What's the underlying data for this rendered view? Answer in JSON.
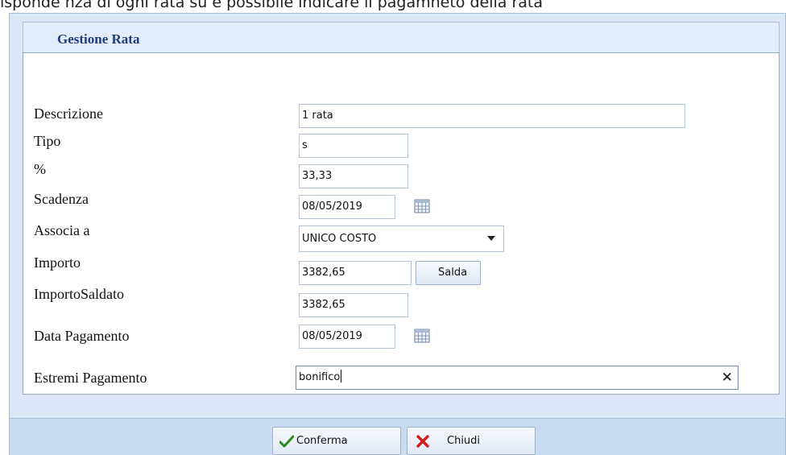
{
  "caption": {
    "text": "isponde nza di ogni rata su        è possibile indicare il pagamneto della rata"
  },
  "dialog": {
    "title": "Gestione Rata"
  },
  "form": {
    "descrizione": {
      "label": "Descrizione",
      "value": "1 rata"
    },
    "tipo": {
      "label": "Tipo",
      "value": "s"
    },
    "percentuale": {
      "label": "%",
      "value": "33,33"
    },
    "scadenza": {
      "label": "Scadenza",
      "value": "08/05/2019"
    },
    "associa": {
      "label": "Associa a",
      "value": "UNICO COSTO"
    },
    "importo": {
      "label": "Importo",
      "value": "3382,65",
      "button_label": "Salda"
    },
    "importo_saldato": {
      "label": "ImportoSaldato",
      "value": "3382,65"
    },
    "data_pagamento": {
      "label": "Data Pagamento",
      "value": "08/05/2019"
    },
    "estremi_pagamento": {
      "label": "Estremi Pagamento",
      "value": "bonifico",
      "clear_glyph": "✕"
    }
  },
  "footer": {
    "confirm_label": "Conferma",
    "close_label": "Chiudi"
  },
  "icons": {
    "calendar": "calendar-icon",
    "confirm": "checkmark-icon",
    "close": "red-x-icon",
    "dropdown": "chevron-down-icon",
    "clear": "clear-icon"
  },
  "colors": {
    "title": "#1f3d7c",
    "dialog_bg": "#dbe7f6",
    "footer_bg": "#c9dbf2",
    "checkmark": "#2f8a1e",
    "close_x": "#d21b1b"
  }
}
